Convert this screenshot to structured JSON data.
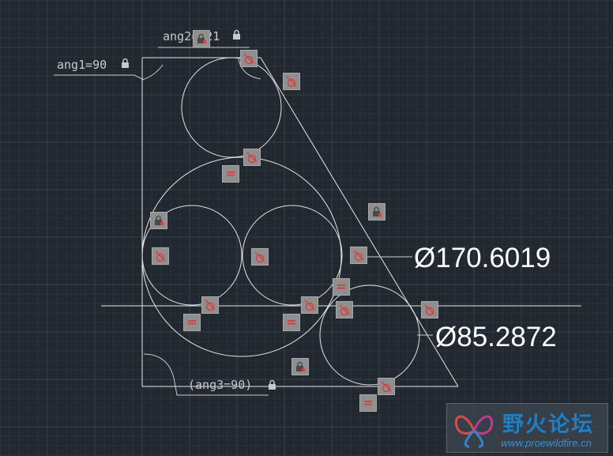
{
  "dimensions": {
    "ang1": "ang1=90",
    "ang2": "ang2=121",
    "ang3": "(ang3=90)",
    "diameter_large": "Ø170.6019",
    "diameter_small": "Ø85.2872"
  },
  "constraint_icons": {
    "tangent": "tangent-constraint-icon",
    "equal": "equal-constraint-icon",
    "lock": "lock-icon",
    "equal_symbol": "="
  },
  "watermark": {
    "title": "野火论坛",
    "url": "www.proewildfire.cn"
  },
  "colors": {
    "background": "#212830",
    "grid_minor": "#2a323d",
    "grid_major": "#36404c",
    "geometry": "#e6e6e6",
    "dimension": "#c9c9c9",
    "glyph_bg": "#8f8f8f",
    "constraint_red": "#e03a3a",
    "watermark_blue": "#1f7fc4"
  }
}
